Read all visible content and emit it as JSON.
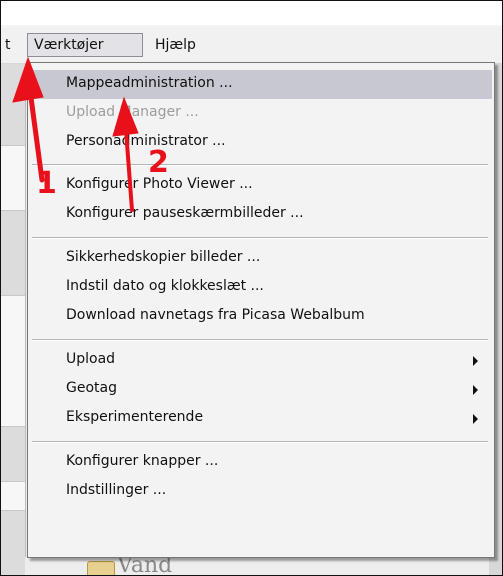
{
  "menubar": {
    "partial_label": "t",
    "tools_label": "Værktøjer",
    "help_label": "Hjælp"
  },
  "menu": {
    "items": [
      {
        "label": "Mappeadministration ...",
        "state": "highlighted"
      },
      {
        "label": "Upload Manager ...",
        "state": "disabled"
      },
      {
        "label": "Personadministrator ..."
      },
      {
        "label": "Konfigurer Photo Viewer ..."
      },
      {
        "label": "Konfigurer pauseskærmbilleder ..."
      },
      {
        "label": "Sikkerhedskopier billeder ..."
      },
      {
        "label": "Indstil dato og klokkeslæt ..."
      },
      {
        "label": "Download navnetags fra Picasa Webalbum"
      },
      {
        "label": "Upload",
        "submenu": true
      },
      {
        "label": "Geotag",
        "submenu": true
      },
      {
        "label": "Eksperimenterende",
        "submenu": true
      },
      {
        "label": "Konfigurer knapper ..."
      },
      {
        "label": "Indstillinger ..."
      }
    ]
  },
  "annotations": {
    "step1": "1",
    "step2": "2",
    "color": "#e8101a"
  },
  "background": {
    "partial_text": "Vand"
  }
}
